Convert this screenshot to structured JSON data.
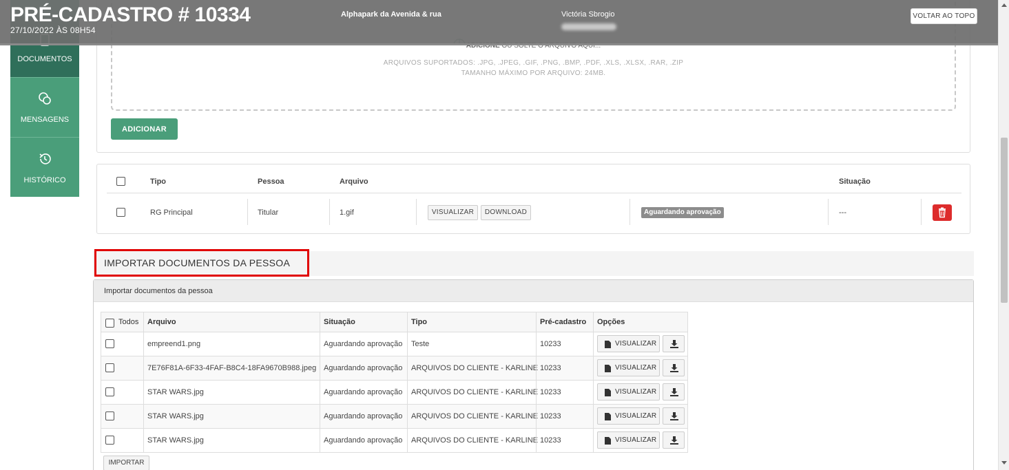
{
  "header": {
    "title": "PRÉ-CADASTRO # 10334",
    "date": "27/10/2022 ÀS 08H54",
    "location": "Alphapark da Avenida & rua",
    "person_name": "Victória Sbrogio",
    "back_to_top": "VOLTAR AO TOPO"
  },
  "sidebar": {
    "items": [
      {
        "label": "DOCUMENTOS",
        "icon": "document-icon",
        "active": true
      },
      {
        "label": "MENSAGENS",
        "icon": "chat-icon",
        "active": false
      },
      {
        "label": "HISTÓRICO",
        "icon": "history-icon",
        "active": false
      }
    ]
  },
  "upload": {
    "add_text_bold": "ADICIONE",
    "add_text_rest": " OU SOLTE O ARQUIVO AQUI...",
    "supported": "ARQUIVOS SUPORTADOS: .JPG, .JPEG, .GIF, .PNG, .BMP, .PDF, .XLS, .XLSX, .RAR, .ZIP",
    "max_size": "TAMANHO MÁXIMO POR ARQUIVO: 24MB.",
    "add_button": "ADICIONAR"
  },
  "docs_table": {
    "headers": {
      "tipo": "Tipo",
      "pessoa": "Pessoa",
      "arquivo": "Arquivo",
      "situacao": "Situação"
    },
    "row": {
      "tipo": "RG Principal",
      "pessoa": "Titular",
      "arquivo": "1.gif",
      "view": "VISUALIZAR",
      "download": "DOWNLOAD",
      "status": "Aguardando aprovação",
      "situacao": "---"
    }
  },
  "import": {
    "section_title": "IMPORTAR DOCUMENTOS DA PESSOA",
    "panel_title": "Importar documentos da pessoa",
    "headers": {
      "todos": "Todos",
      "arquivo": "Arquivo",
      "situacao": "Situação",
      "tipo": "Tipo",
      "precadastro": "Pré-cadastro",
      "opcoes": "Opções"
    },
    "view_label": "VISUALIZAR",
    "rows": [
      {
        "arquivo": "empreend1.png",
        "situacao": "Aguardando aprovação",
        "tipo": "Teste",
        "precadastro": "10233"
      },
      {
        "arquivo": "7E76F81A-6F33-4FAF-B8C4-18FA9670B988.jpeg",
        "situacao": "Aguardando aprovação",
        "tipo": "ARQUIVOS DO CLIENTE - KARLINE",
        "precadastro": "10233"
      },
      {
        "arquivo": "STAR WARS.jpg",
        "situacao": "Aguardando aprovação",
        "tipo": "ARQUIVOS DO CLIENTE - KARLINE",
        "precadastro": "10233"
      },
      {
        "arquivo": "STAR WARS.jpg",
        "situacao": "Aguardando aprovação",
        "tipo": "ARQUIVOS DO CLIENTE - KARLINE",
        "precadastro": "10233"
      },
      {
        "arquivo": "STAR WARS.jpg",
        "situacao": "Aguardando aprovação",
        "tipo": "ARQUIVOS DO CLIENTE - KARLINE",
        "precadastro": "10233"
      }
    ],
    "import_button": "IMPORTAR"
  },
  "colors": {
    "accent_green": "#4a9e7a",
    "active_green": "#2f6f5a",
    "delete_red": "#dd2c2c",
    "highlight_red": "#e00000"
  }
}
